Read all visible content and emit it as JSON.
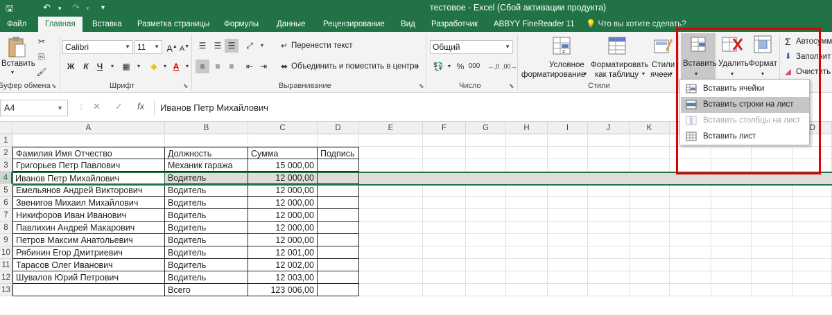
{
  "title": "тестовое - Excel (Сбой активации продукта)",
  "tabs": [
    "Файл",
    "Главная",
    "Вставка",
    "Разметка страницы",
    "Формулы",
    "Данные",
    "Рецензирование",
    "Вид",
    "Разработчик",
    "ABBYY FineReader 11"
  ],
  "active_tab": "Главная",
  "tell_me": "Что вы хотите сделать?",
  "ribbon": {
    "clipboard": {
      "paste": "Вставить",
      "label": "Буфер обмена"
    },
    "font": {
      "name": "Calibri",
      "size": "11",
      "bold": "Ж",
      "italic": "К",
      "underline": "Ч",
      "label": "Шрифт"
    },
    "alignment": {
      "wrap": "Перенести текст",
      "merge": "Объединить и поместить в центре",
      "label": "Выравнивание"
    },
    "number": {
      "format": "Общий",
      "percent": "%",
      "thousands": "000",
      "label": "Число"
    },
    "styles": {
      "conditional_1": "Условное",
      "conditional_2": "форматирование",
      "table_1": "Форматировать",
      "table_2": "как таблицу",
      "cell_1": "Стили",
      "cell_2": "ячеек",
      "label": "Стили"
    },
    "cells": {
      "insert": "Вставить",
      "delete": "Удалить",
      "format": "Формат"
    },
    "editing": {
      "autosum": "Автосумм",
      "fill": "Заполнит",
      "clear": "Очистить"
    }
  },
  "name_box": "A4",
  "formula": "Иванов Петр Михайлович",
  "columns": [
    "A",
    "B",
    "C",
    "D",
    "E",
    "F",
    "G",
    "H",
    "I",
    "J",
    "K",
    "L",
    "M",
    "N",
    "O"
  ],
  "rows": [
    "1",
    "2",
    "3",
    "4",
    "5",
    "6",
    "7",
    "8",
    "9",
    "10",
    "11",
    "12",
    "13"
  ],
  "table": {
    "headers": [
      "Фамилия Имя Отчество",
      "Должность",
      "Сумма",
      "Подпись"
    ],
    "data": [
      [
        "Григорьев Петр Павлович",
        "Механик гаража",
        "15 000,00"
      ],
      [
        "Иванов Петр Михайлович",
        "Водитель",
        "12 000,00"
      ],
      [
        "Емельянов Андрей Викторович",
        "Водитель",
        "12 000,00"
      ],
      [
        "Звенигов Михаил Михайлович",
        "Водитель",
        "12 000,00"
      ],
      [
        "Никифоров Иван Иванович",
        "Водитель",
        "12 000,00"
      ],
      [
        "Павлихин Андрей Макарович",
        "Водитель",
        "12 000,00"
      ],
      [
        "Петров Максим Анатольевич",
        "Водитель",
        "12 000,00"
      ],
      [
        "Рябинин Егор Дмитриевич",
        "Водитель",
        "12 001,00"
      ],
      [
        "Тарасов Олег Иванович",
        "Водитель",
        "12 002,00"
      ],
      [
        "Шувалов Юрий Петрович",
        "Водитель",
        "12 003,00"
      ]
    ],
    "total_label": "Всего",
    "total_value": "123 006,00"
  },
  "insert_menu": [
    {
      "label": "Вставить ячейки",
      "state": "normal"
    },
    {
      "label": "Вставить строки на лист",
      "state": "highlighted"
    },
    {
      "label": "Вставить столбцы на лист",
      "state": "disabled"
    },
    {
      "label": "Вставить лист",
      "state": "normal"
    }
  ],
  "colors": {
    "excel_green": "#217346",
    "highlight_box": "#e00000",
    "selection": "#c6c6c6"
  }
}
